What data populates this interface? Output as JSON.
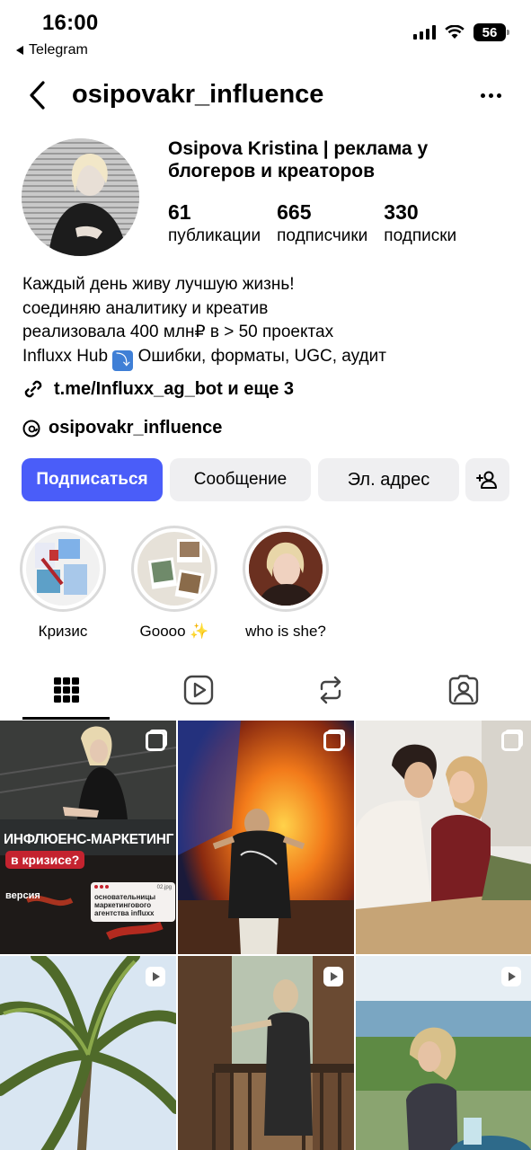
{
  "status_bar": {
    "time": "16:00",
    "back_app": "Telegram",
    "battery": "56"
  },
  "header": {
    "username": "osipovakr_influence"
  },
  "profile": {
    "name": "Osipova Kristina | реклама у блогеров и креаторов",
    "stats": [
      {
        "value": "61",
        "label": "публикации"
      },
      {
        "value": "665",
        "label": "подписчики"
      },
      {
        "value": "330",
        "label": "подписки"
      }
    ],
    "bio": {
      "line1": "Каждый день живу лучшую жизнь!",
      "line2": "соединяю аналитику и креатив",
      "line3": "реализовала 400 млн₽ в > 50 проектах",
      "line4_a": "Influxx Hub",
      "line4_emoji": "⤵",
      "line4_b": " Ошибки, форматы, UGC, аудит"
    },
    "link": "t.me/Influxx_ag_bot и еще 3",
    "threads": "osipovakr_influence"
  },
  "actions": {
    "follow": "Подписаться",
    "message": "Сообщение",
    "email": "Эл. адрес"
  },
  "highlights": [
    {
      "label": "Кризис"
    },
    {
      "label": "Goooo ✨"
    },
    {
      "label": "who is she?"
    }
  ],
  "tabs": [
    "grid-icon",
    "reels-icon",
    "reposts-icon",
    "tagged-icon"
  ],
  "posts": {
    "post1": {
      "title": "ИНФЛЮЕНС-МАРКЕТИНГ",
      "pill": "в кризисе?",
      "small": "версия",
      "card_file": "02.jpg",
      "card_text_1": "основательницы",
      "card_text_2": "маркетингового",
      "card_text_3": "агентства influxx"
    }
  },
  "colors": {
    "accent": "#4a5df9",
    "button_bg": "#efeff1",
    "pill_red": "#c4232f"
  }
}
